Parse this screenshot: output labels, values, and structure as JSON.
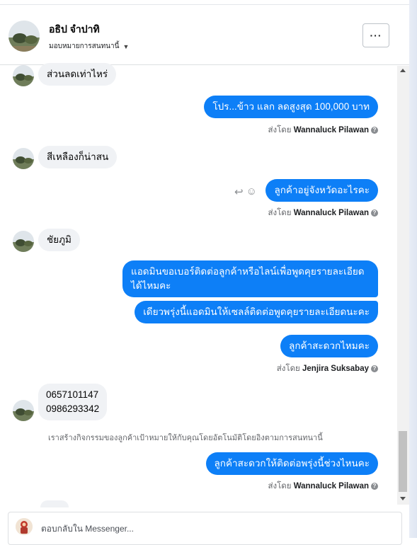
{
  "header": {
    "contact_name": "อธิป จำปาทิ",
    "assign_label": "มอบหมายการสนทนานี้",
    "more_label": "···"
  },
  "messages": [
    {
      "type": "in",
      "text": "ส่วนลดเท่าไหร่"
    },
    {
      "type": "out",
      "text": "โปร...ข้าว แลก ลดสูงสุด  100,000 บาท"
    },
    {
      "type": "sent_by",
      "prefix": "ส่งโดย",
      "name": "Wannaluck Pilawan"
    },
    {
      "type": "in",
      "text": "สีเหลืองก็น่าสน"
    },
    {
      "type": "out",
      "text": "ลูกค้าอยู่จังหวัดอะไรคะ"
    },
    {
      "type": "sent_by",
      "prefix": "ส่งโดย",
      "name": "Wannaluck Pilawan"
    },
    {
      "type": "in",
      "text": "ชัยภูมิ"
    },
    {
      "type": "out",
      "line1": "แอดมินขอเบอร์ติดต่อลูกค้าหรือไลน์เพื่อพูดคุยรายละเอียด",
      "line2": "ได้ไหมคะ"
    },
    {
      "type": "out",
      "text": "เดียวพรุ่งนี้แอดมินให้เซลล์ติดต่อพูดคุยรายละเอียดนะคะ"
    },
    {
      "type": "out",
      "text": "ลูกค้าสะดวกไหมคะ"
    },
    {
      "type": "sent_by",
      "prefix": "ส่งโดย",
      "name": "Jenjira Suksabay"
    },
    {
      "type": "in",
      "line1": "0657101147",
      "line2": "0986293342"
    },
    {
      "type": "system",
      "text": "เราสร้างกิจกรรมของลูกค้าเป้าหมายให้กับคุณโดยอัตโนมัติโดยอิงตามการสนทนานี้"
    },
    {
      "type": "out",
      "text": "ลูกค้าสะดวกให้ติดต่อพรุ่งนี้ช่วงไหนคะ"
    },
    {
      "type": "sent_by",
      "prefix": "ส่งโดย",
      "name": "Wannaluck Pilawan"
    }
  ],
  "composer": {
    "placeholder": "ตอบกลับใน Messenger..."
  },
  "icons": {
    "reply": "↩",
    "emoji": "☺",
    "help": "?"
  },
  "colors": {
    "outgoing_bubble": "#0d7ff7",
    "incoming_bubble": "#f0f2f5"
  }
}
